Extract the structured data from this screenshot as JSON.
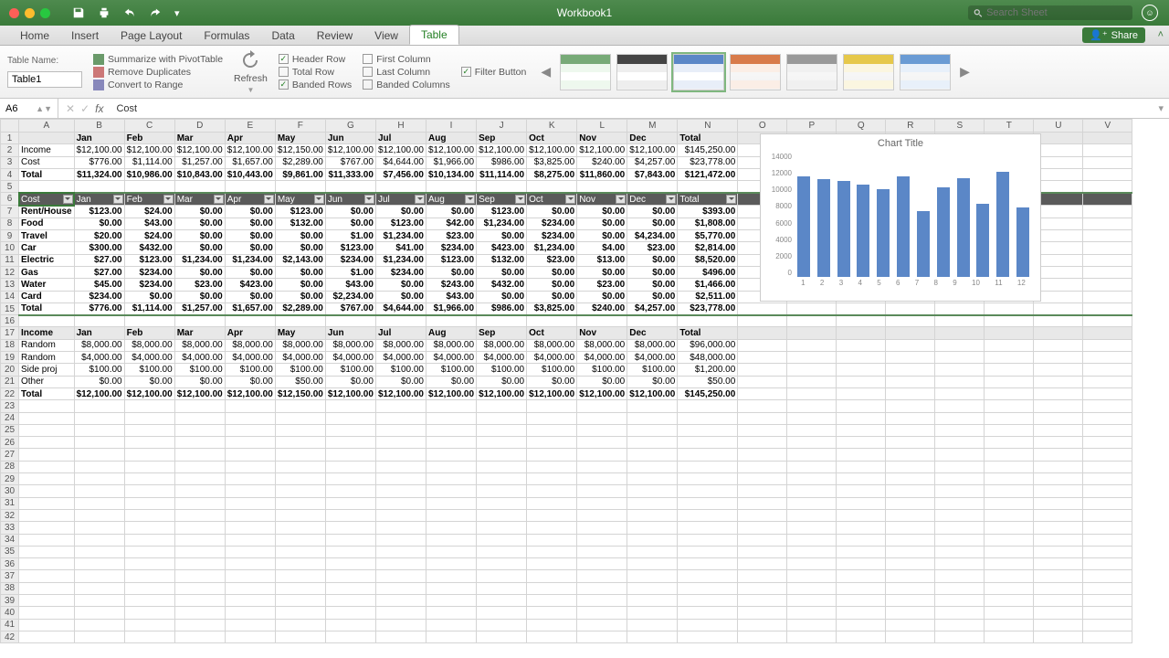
{
  "window": {
    "title": "Workbook1",
    "search_placeholder": "Search Sheet"
  },
  "menubar": {
    "tabs": [
      "Home",
      "Insert",
      "Page Layout",
      "Formulas",
      "Data",
      "Review",
      "View",
      "Table"
    ],
    "active": 7,
    "share": "Share"
  },
  "ribbon": {
    "tablename_label": "Table Name:",
    "tablename": "Table1",
    "pivot": "Summarize with PivotTable",
    "dedupe": "Remove Duplicates",
    "convert": "Convert to Range",
    "refresh": "Refresh",
    "opts": {
      "header_row": "Header Row",
      "total_row": "Total Row",
      "banded_rows": "Banded Rows",
      "first_col": "First Column",
      "last_col": "Last Column",
      "banded_cols": "Banded Columns",
      "filter": "Filter Button"
    }
  },
  "namebox": "A6",
  "formula": "Cost",
  "columns": [
    "A",
    "B",
    "C",
    "D",
    "E",
    "F",
    "G",
    "H",
    "I",
    "J",
    "K",
    "L",
    "M",
    "N",
    "O",
    "P",
    "Q",
    "R",
    "S",
    "T",
    "U",
    "V"
  ],
  "months": [
    "Jan",
    "Feb",
    "Mar",
    "Apr",
    "May",
    "Jun",
    "Jul",
    "Aug",
    "Sep",
    "Oct",
    "Nov",
    "Dec",
    "Total"
  ],
  "top": {
    "labels": [
      "Income",
      "Cost",
      "Total"
    ],
    "rows": [
      [
        "$12,100.00",
        "$12,100.00",
        "$12,100.00",
        "$12,100.00",
        "$12,150.00",
        "$12,100.00",
        "$12,100.00",
        "$12,100.00",
        "$12,100.00",
        "$12,100.00",
        "$12,100.00",
        "$12,100.00",
        "$145,250.00"
      ],
      [
        "$776.00",
        "$1,114.00",
        "$1,257.00",
        "$1,657.00",
        "$2,289.00",
        "$767.00",
        "$4,644.00",
        "$1,966.00",
        "$986.00",
        "$3,825.00",
        "$240.00",
        "$4,257.00",
        "$23,778.00"
      ],
      [
        "$11,324.00",
        "$10,986.00",
        "$10,843.00",
        "$10,443.00",
        "$9,861.00",
        "$11,333.00",
        "$7,456.00",
        "$10,134.00",
        "$11,114.00",
        "$8,275.00",
        "$11,860.00",
        "$7,843.00",
        "$121,472.00"
      ]
    ]
  },
  "filter_header": "Cost",
  "costs": {
    "labels": [
      "Rent/House",
      "Food",
      "Travel",
      "Car",
      "Electric",
      "Gas",
      "Water",
      "Card",
      "Total"
    ],
    "rows": [
      [
        "$123.00",
        "$24.00",
        "$0.00",
        "$0.00",
        "$123.00",
        "$0.00",
        "$0.00",
        "$0.00",
        "$123.00",
        "$0.00",
        "$0.00",
        "$0.00",
        "$393.00"
      ],
      [
        "$0.00",
        "$43.00",
        "$0.00",
        "$0.00",
        "$132.00",
        "$0.00",
        "$123.00",
        "$42.00",
        "$1,234.00",
        "$234.00",
        "$0.00",
        "$0.00",
        "$1,808.00"
      ],
      [
        "$20.00",
        "$24.00",
        "$0.00",
        "$0.00",
        "$0.00",
        "$1.00",
        "$1,234.00",
        "$23.00",
        "$0.00",
        "$234.00",
        "$0.00",
        "$4,234.00",
        "$5,770.00"
      ],
      [
        "$300.00",
        "$432.00",
        "$0.00",
        "$0.00",
        "$0.00",
        "$123.00",
        "$41.00",
        "$234.00",
        "$423.00",
        "$1,234.00",
        "$4.00",
        "$23.00",
        "$2,814.00"
      ],
      [
        "$27.00",
        "$123.00",
        "$1,234.00",
        "$1,234.00",
        "$2,143.00",
        "$234.00",
        "$1,234.00",
        "$123.00",
        "$132.00",
        "$23.00",
        "$13.00",
        "$0.00",
        "$8,520.00"
      ],
      [
        "$27.00",
        "$234.00",
        "$0.00",
        "$0.00",
        "$0.00",
        "$1.00",
        "$234.00",
        "$0.00",
        "$0.00",
        "$0.00",
        "$0.00",
        "$0.00",
        "$496.00"
      ],
      [
        "$45.00",
        "$234.00",
        "$23.00",
        "$423.00",
        "$0.00",
        "$43.00",
        "$0.00",
        "$243.00",
        "$432.00",
        "$0.00",
        "$23.00",
        "$0.00",
        "$1,466.00"
      ],
      [
        "$234.00",
        "$0.00",
        "$0.00",
        "$0.00",
        "$0.00",
        "$2,234.00",
        "$0.00",
        "$43.00",
        "$0.00",
        "$0.00",
        "$0.00",
        "$0.00",
        "$2,511.00"
      ],
      [
        "$776.00",
        "$1,114.00",
        "$1,257.00",
        "$1,657.00",
        "$2,289.00",
        "$767.00",
        "$4,644.00",
        "$1,966.00",
        "$986.00",
        "$3,825.00",
        "$240.00",
        "$4,257.00",
        "$23,778.00"
      ]
    ]
  },
  "income": {
    "header_label": "Income",
    "labels": [
      "Random",
      "Random",
      "Side proj",
      "Other",
      "Total"
    ],
    "rows": [
      [
        "$8,000.00",
        "$8,000.00",
        "$8,000.00",
        "$8,000.00",
        "$8,000.00",
        "$8,000.00",
        "$8,000.00",
        "$8,000.00",
        "$8,000.00",
        "$8,000.00",
        "$8,000.00",
        "$8,000.00",
        "$96,000.00"
      ],
      [
        "$4,000.00",
        "$4,000.00",
        "$4,000.00",
        "$4,000.00",
        "$4,000.00",
        "$4,000.00",
        "$4,000.00",
        "$4,000.00",
        "$4,000.00",
        "$4,000.00",
        "$4,000.00",
        "$4,000.00",
        "$48,000.00"
      ],
      [
        "$100.00",
        "$100.00",
        "$100.00",
        "$100.00",
        "$100.00",
        "$100.00",
        "$100.00",
        "$100.00",
        "$100.00",
        "$100.00",
        "$100.00",
        "$100.00",
        "$1,200.00"
      ],
      [
        "$0.00",
        "$0.00",
        "$0.00",
        "$0.00",
        "$50.00",
        "$0.00",
        "$0.00",
        "$0.00",
        "$0.00",
        "$0.00",
        "$0.00",
        "$0.00",
        "$50.00"
      ],
      [
        "$12,100.00",
        "$12,100.00",
        "$12,100.00",
        "$12,100.00",
        "$12,150.00",
        "$12,100.00",
        "$12,100.00",
        "$12,100.00",
        "$12,100.00",
        "$12,100.00",
        "$12,100.00",
        "$12,100.00",
        "$145,250.00"
      ]
    ]
  },
  "chart_data": {
    "type": "bar",
    "title": "Chart Title",
    "categories": [
      "1",
      "2",
      "3",
      "4",
      "5",
      "6",
      "7",
      "8",
      "9",
      "10",
      "11",
      "12"
    ],
    "values": [
      11324,
      10986,
      10843,
      10443,
      9861,
      11333,
      7456,
      10134,
      11114,
      8275,
      11860,
      7843
    ],
    "ylim": [
      0,
      14000
    ],
    "yticks": [
      "0",
      "2000",
      "4000",
      "6000",
      "8000",
      "10000",
      "12000",
      "14000"
    ]
  }
}
